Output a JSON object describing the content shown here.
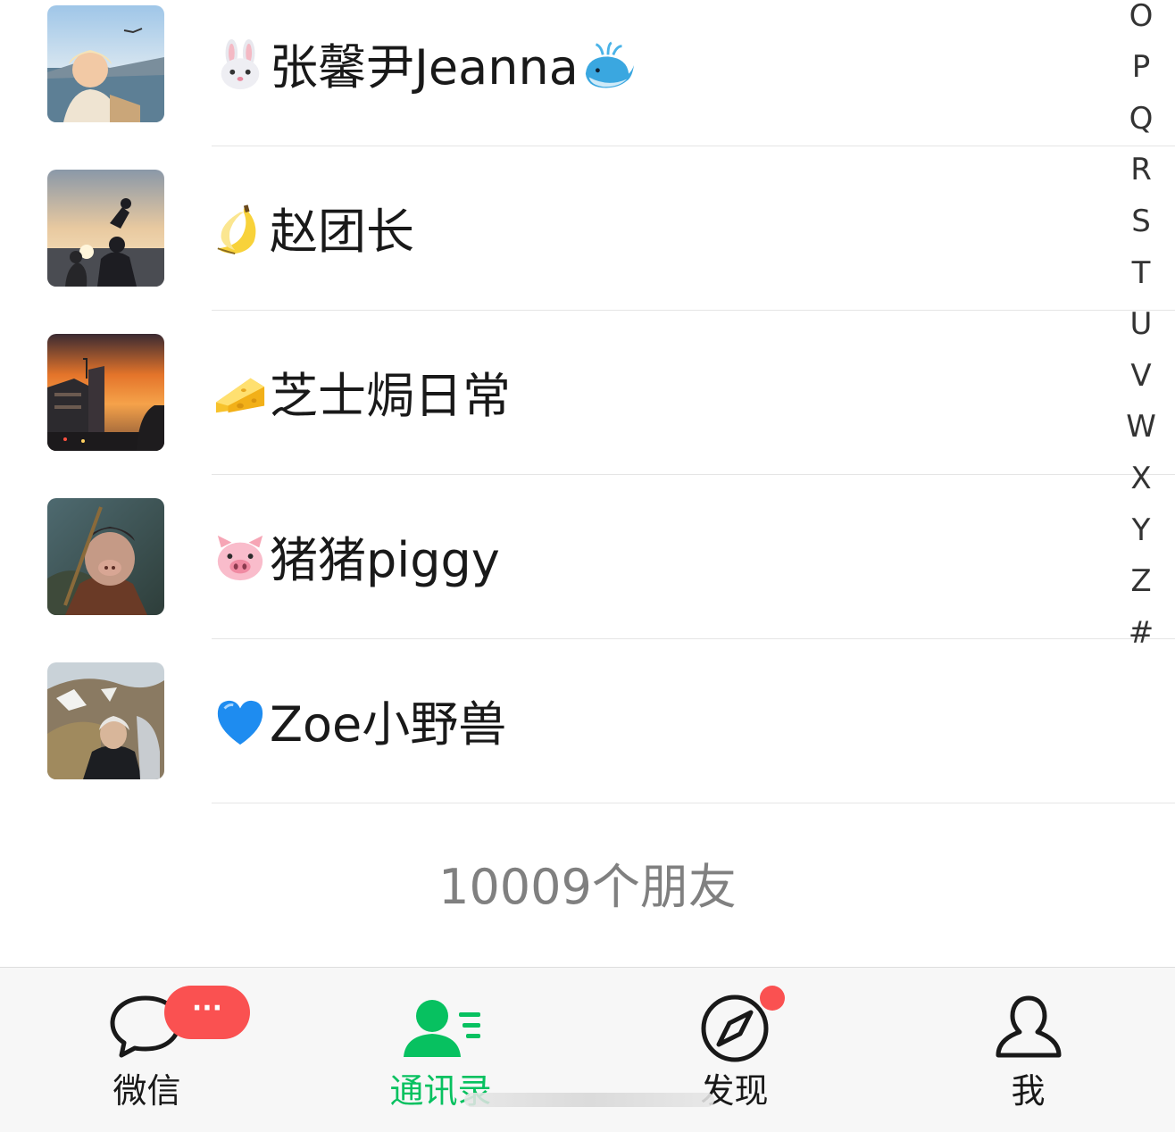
{
  "contacts": [
    {
      "name": "张馨尹Jeanna",
      "lead_emoji": "rabbit-face",
      "trail_emoji": "spouting-whale"
    },
    {
      "name": "赵团长",
      "lead_emoji": "banana"
    },
    {
      "name": "芝士焗日常",
      "lead_emoji": "cheese-wedge"
    },
    {
      "name": "猪猪piggy",
      "lead_emoji": "pig-face"
    },
    {
      "name": "Zoe小野兽",
      "lead_emoji": "blue-heart"
    }
  ],
  "index_bar": {
    "letters": [
      "O",
      "P",
      "Q",
      "R",
      "S",
      "T",
      "U",
      "V",
      "W",
      "X",
      "Y",
      "Z",
      "#"
    ]
  },
  "footer": {
    "friend_count": "10009个朋友"
  },
  "tabbar": {
    "tabs": [
      {
        "label": "微信",
        "icon": "chat-bubble-icon",
        "badge": "···"
      },
      {
        "label": "通讯录",
        "icon": "contacts-icon",
        "active": true
      },
      {
        "label": "发现",
        "icon": "compass-icon",
        "dot": true
      },
      {
        "label": "我",
        "icon": "person-icon"
      }
    ]
  },
  "colors": {
    "accent": "#07c160",
    "badge": "#fa5151",
    "text": "#191919",
    "muted": "#808080",
    "divider": "#e5e5e5",
    "tabbar_bg": "#f7f7f7"
  }
}
